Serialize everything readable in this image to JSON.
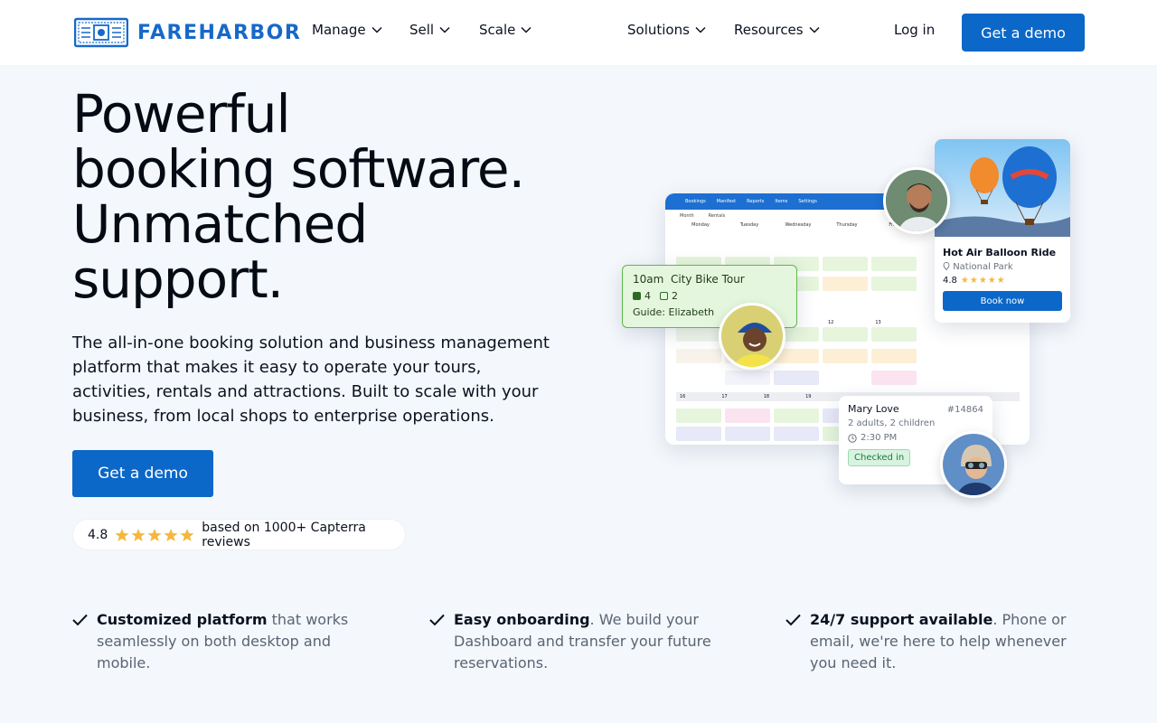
{
  "header": {
    "logo_text": "FAREHARBOR",
    "nav_left": [
      {
        "label": "Manage"
      },
      {
        "label": "Sell"
      },
      {
        "label": "Scale"
      }
    ],
    "nav_right": [
      {
        "label": "Solutions"
      },
      {
        "label": "Resources"
      }
    ],
    "login_label": "Log in",
    "demo_label": "Get a demo"
  },
  "hero": {
    "title_lines": [
      "Powerful",
      "booking software.",
      "Unmatched",
      "support."
    ],
    "description": "The all-in-one booking solution and business management platform that makes it easy to operate your tours, activities, rentals and attractions. Built to scale with your business, from local shops to enterprise operations.",
    "cta_label": "Get a demo",
    "rating": {
      "score": "4.8",
      "stars": 5,
      "text": "based on 1000+ Capterra reviews"
    }
  },
  "features": [
    {
      "bold": "Customized platform",
      "rest": " that works seamlessly on both desktop and mobile."
    },
    {
      "bold": "Easy onboarding",
      "rest": ". We build your Dashboard and transfer your future reservations."
    },
    {
      "bold": "24/7 support available",
      "rest": ". Phone or email, we're here to help whenever you need it."
    }
  ],
  "illustration": {
    "dashboard": {
      "tabs": [
        "Bookings",
        "Manifest",
        "Reports",
        "Items",
        "Settings"
      ],
      "filters": [
        "Month",
        "Rentals"
      ],
      "days": [
        "Monday",
        "Tuesday",
        "Wednesday",
        "Thursday",
        "Friday"
      ],
      "dates_row1": [
        "12",
        "13"
      ],
      "dates_row2": [
        "16",
        "17",
        "18",
        "19"
      ]
    },
    "tour_card": {
      "time": "10am",
      "name": "City Bike Tour",
      "count_a": "4",
      "count_b": "2",
      "guide": "Guide: Elizabeth"
    },
    "balloon_card": {
      "title": "Hot Air Balloon Ride",
      "location": "National Park",
      "rating": "4.8",
      "button": "Book now"
    },
    "guest_card": {
      "name": "Mary Love",
      "id": "#14864",
      "party": "2 adults, 2 children",
      "time": "2:30 PM",
      "status": "Checked in"
    }
  },
  "colors": {
    "primary": "#0b67c8",
    "logo": "#1669c9",
    "star": "#f5b83d",
    "background": "#f4f7fb"
  }
}
